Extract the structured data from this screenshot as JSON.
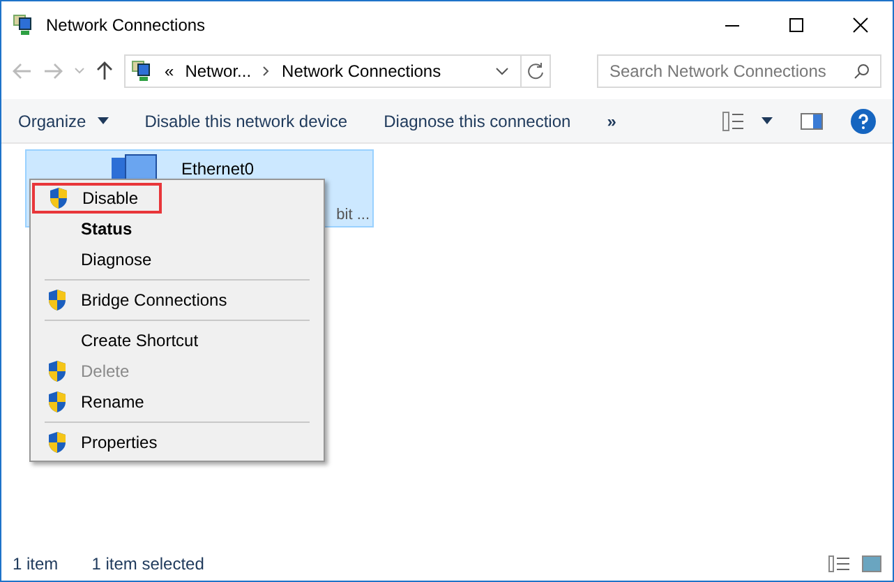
{
  "window": {
    "title": "Network Connections"
  },
  "address_bar": {
    "overflow": "«",
    "crumbs": [
      "Networ...",
      "Network Connections"
    ]
  },
  "search": {
    "placeholder": "Search Network Connections"
  },
  "toolbar": {
    "items": [
      {
        "label": "Organize",
        "dropdown": true
      },
      {
        "label": "Disable this network device",
        "dropdown": false
      },
      {
        "label": "Diagnose this connection",
        "dropdown": false
      }
    ],
    "more": "»"
  },
  "connection": {
    "name": "Ethernet0",
    "detail_fragment": "bit ...",
    "selected": true
  },
  "context_menu": {
    "groups": [
      [
        {
          "label": "Disable",
          "shield": true,
          "bold": false,
          "disabled": false,
          "highlighted": true
        },
        {
          "label": "Status",
          "shield": false,
          "bold": true,
          "disabled": false,
          "highlighted": false
        },
        {
          "label": "Diagnose",
          "shield": false,
          "bold": false,
          "disabled": false,
          "highlighted": false
        }
      ],
      [
        {
          "label": "Bridge Connections",
          "shield": true,
          "bold": false,
          "disabled": false,
          "highlighted": false
        }
      ],
      [
        {
          "label": "Create Shortcut",
          "shield": false,
          "bold": false,
          "disabled": false,
          "highlighted": false
        },
        {
          "label": "Delete",
          "shield": true,
          "bold": false,
          "disabled": true,
          "highlighted": false
        },
        {
          "label": "Rename",
          "shield": true,
          "bold": false,
          "disabled": false,
          "highlighted": false
        }
      ],
      [
        {
          "label": "Properties",
          "shield": true,
          "bold": false,
          "disabled": false,
          "highlighted": false
        }
      ]
    ]
  },
  "status_bar": {
    "count": "1 item",
    "selection": "1 item selected"
  }
}
